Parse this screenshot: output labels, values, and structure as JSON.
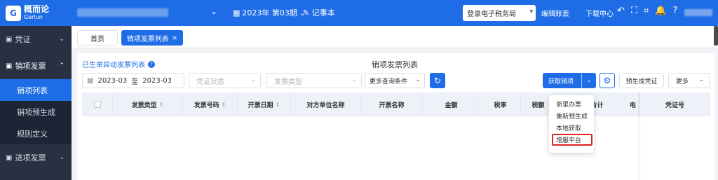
{
  "brand": {
    "logo_mark": "G",
    "name_cn": "概而论",
    "name_en": "Gerlun"
  },
  "topbar": {
    "period": "2023年 第03期",
    "notebook": "记事本",
    "tax_bureau": "登录电子税务局",
    "edit_books": "编辑账套",
    "download_center": "下载中心",
    "icons": [
      "undo-icon",
      "fullscreen-icon",
      "scan-icon",
      "bell-icon",
      "help-icon"
    ]
  },
  "sidebar": {
    "groups": [
      {
        "label": "凭证",
        "icon": "voucher-icon"
      },
      {
        "label": "销项发票",
        "icon": "invoice-icon"
      },
      {
        "label": "进项发票",
        "icon": "invoice-in-icon"
      }
    ],
    "sub_items": [
      "销项列表",
      "销项预生成",
      "规则定义"
    ]
  },
  "tabs": {
    "home": "首页",
    "current": "销项发票列表",
    "close": "×"
  },
  "main": {
    "sub_title": "已生单异动发票列表",
    "page_title": "销项发票列表",
    "filters": {
      "date_start": "2023-03",
      "date_sep": "至",
      "date_end": "2023-03",
      "status_placeholder": "凭证状态",
      "type_placeholder": "发票类型",
      "more_conditions": "更多查询条件"
    },
    "buttons": {
      "fetch": "获取销项",
      "pregen": "预生成凭证",
      "more": "更多"
    },
    "table_headers": [
      "发票类型",
      "发票号码",
      "开票日期",
      "对方单位名称",
      "开票名称",
      "金额",
      "税率",
      "税额",
      "价税合计",
      "电",
      "凭证号"
    ]
  },
  "fetch_menu": {
    "items": [
      "浙里办票",
      "重新预生成",
      "本地获取",
      "增服平台"
    ],
    "highlight_color": "#e02020"
  },
  "colors": {
    "primary": "#1f6de6",
    "sidebar": "#273142"
  }
}
